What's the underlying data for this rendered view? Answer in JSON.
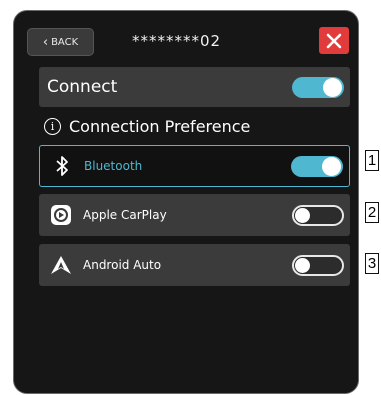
{
  "header": {
    "back_label": "BACK",
    "device_name": "********02",
    "close_icon": "close-x-icon"
  },
  "connect": {
    "label": "Connect",
    "state": "on"
  },
  "preference": {
    "label": "Connection Preference",
    "icon": "info-icon"
  },
  "options": [
    {
      "label": "Bluetooth",
      "icon": "bluetooth-icon",
      "state": "on",
      "selected": true
    },
    {
      "label": "Apple CarPlay",
      "icon": "carplay-icon",
      "state": "off",
      "selected": false
    },
    {
      "label": "Android Auto",
      "icon": "android-auto-icon",
      "state": "off",
      "selected": false
    }
  ],
  "callouts": [
    "1",
    "2",
    "3"
  ],
  "colors": {
    "accent": "#4fb7cf",
    "close": "#e13b3b",
    "row_bg": "#3b3b3b",
    "screen_bg": "#161616"
  }
}
